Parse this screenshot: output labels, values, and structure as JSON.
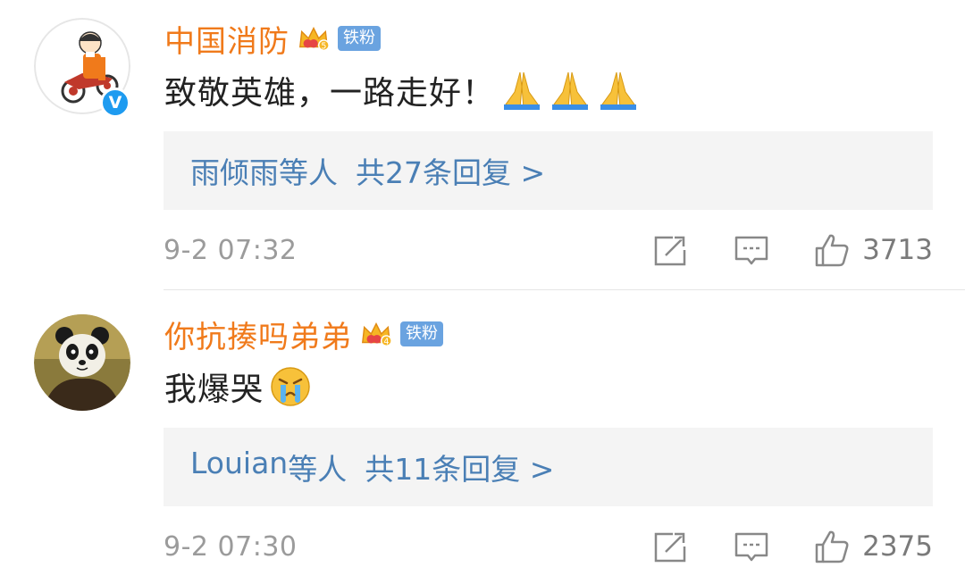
{
  "comments": [
    {
      "username": "中国消防",
      "crown_level": "5",
      "fan_badge": "铁粉",
      "verified": "V",
      "text": "致敬英雄，一路走好！",
      "emoji": [
        "folded-hands",
        "folded-hands",
        "folded-hands"
      ],
      "replies": {
        "who": "雨倾雨",
        "etc": "等人",
        "count_text": "共27条回复 >"
      },
      "time": "9-2 07:32",
      "likes": "3713"
    },
    {
      "username": "你抗揍吗弟弟",
      "crown_level": "4",
      "fan_badge": "铁粉",
      "text": "我爆哭",
      "emoji": [
        "crying-face"
      ],
      "replies": {
        "who": "Louian",
        "etc": "等人",
        "count_text": "共11条回复 >"
      },
      "time": "9-2 07:30",
      "likes": "2375"
    }
  ],
  "icons": {
    "share": "share-icon",
    "comment": "comment-icon",
    "like": "thumbs-up-icon"
  },
  "colors": {
    "username": "#f07a1b",
    "link": "#4a7fb5",
    "badge": "#6aa3e0",
    "verified": "#1e9bf0",
    "reply_bg": "#f4f4f4",
    "meta": "#9b9b9b"
  }
}
